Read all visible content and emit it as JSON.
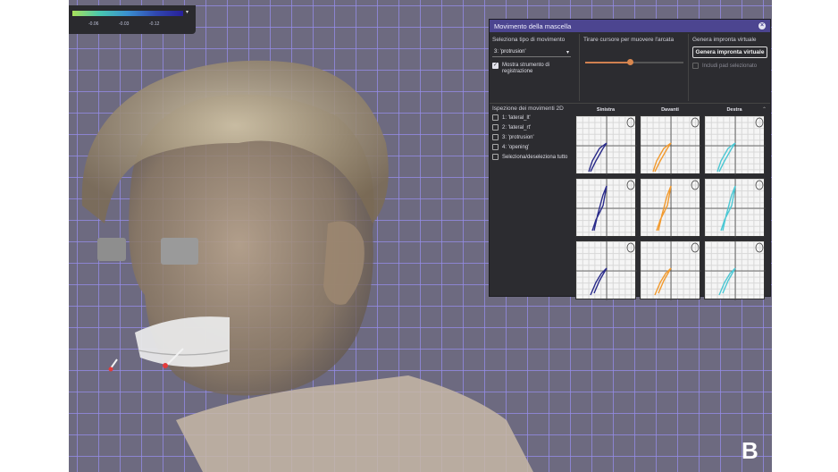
{
  "colorbar": {
    "ticks": [
      "-0.06",
      "-0.03",
      "-0.12"
    ],
    "caret": "▾",
    "colors": [
      "#a9e05a",
      "#48c7b0",
      "#3a8fd0",
      "#3048b0",
      "#28209a"
    ]
  },
  "panel": {
    "title": "Movimento della mascella",
    "close_icon": "close-icon",
    "movement_type": {
      "label": "Seleziona tipo di movimento",
      "selected": "3: 'protrusion'",
      "caret": "▾",
      "checkbox_label": "Mostra strumento di registrazione",
      "checkbox_checked": true
    },
    "slider": {
      "label": "Tirare cursore per muovere l'arcata",
      "value": 0.45,
      "accent": "#d9874e"
    },
    "virtual": {
      "label": "Genera impronta virtuale",
      "button_label": "Genera impronta virtuale",
      "disabled_checkbox_label": "Includi pad selezionato"
    },
    "inspection": {
      "label": "Ispezione dei movimenti 2D",
      "collapse_icon": "chevron-up-icon",
      "movements": [
        {
          "label": "1: 'lateral_lt'",
          "checked": false
        },
        {
          "label": "2: 'lateral_rt'",
          "checked": false
        },
        {
          "label": "3: 'protrusion'",
          "checked": false
        },
        {
          "label": "4: 'opening'",
          "checked": false
        },
        {
          "label": "Seleziona/deseleziona tutto",
          "checked": false
        }
      ],
      "columns": [
        "Sinistra",
        "Davanti",
        "Destra"
      ],
      "views": [
        "ear-view-icon",
        "skull-front-icon",
        "head-profile-icon"
      ]
    }
  },
  "panel_letter": "B",
  "trace_colors": [
    "#2a2b8a",
    "#f29a2e",
    "#4cc8d4"
  ]
}
